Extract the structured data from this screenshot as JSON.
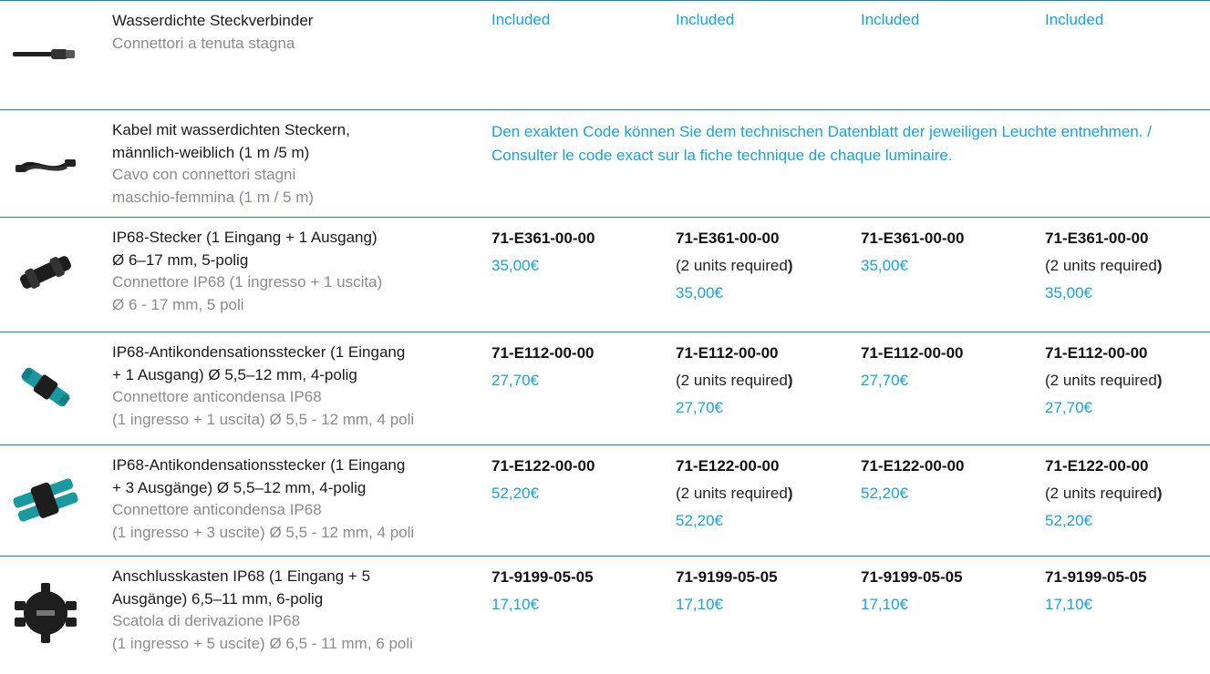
{
  "colors": {
    "accent": "#1aa0dd",
    "rule": "#1f7fc0",
    "secondary_text": "#8b8b8b"
  },
  "rows": [
    {
      "icon": "cable-connector-icon",
      "de": "Wasserdichte Steckverbinder",
      "it_lines": [
        "Connettori a tenuta stagna"
      ],
      "de_lines": [
        "Wasserdichte Steckverbinder"
      ],
      "cells": [
        "Included",
        "Included",
        "Included",
        "Included"
      ]
    },
    {
      "icon": "cable-with-plugs-icon",
      "de_lines": [
        "Kabel mit wasserdichten Steckern,",
        "männlich-weiblich (1 m /5 m)"
      ],
      "it_lines": [
        "Cavo con connettori stagni",
        "maschio-femmina (1 m / 5 m)"
      ],
      "note": "Den exakten Code können Sie dem technischen Datenblatt der jeweiligen Leuchte entnehmen. / Consulter le code exact sur la fiche technique de chaque luminaire."
    },
    {
      "icon": "ip68-connector-icon",
      "de_lines": [
        "IP68-Stecker (1 Eingang + 1 Ausgang)",
        "Ø 6–17 mm, 5-polig"
      ],
      "it_lines": [
        "Connettore IP68 (1 ingresso + 1 uscita)",
        "Ø 6 - 17 mm, 5 poli"
      ],
      "code": "71-E361-00-00",
      "price": "35,00€",
      "units_note": "(2 units required",
      "units_close": ")"
    },
    {
      "icon": "anti-condensation-connector-icon",
      "de_lines": [
        "IP68-Antikondensationsstecker (1 Eingang",
        "+ 1 Ausgang) Ø 5,5–12 mm, 4-polig"
      ],
      "it_lines": [
        "Connettore anticondensa IP68",
        "(1 ingresso + 1 uscita) Ø 5,5 - 12 mm, 4 poli"
      ],
      "code": "71-E112-00-00",
      "price": "27,70€",
      "units_note": "(2 units required",
      "units_close": ")"
    },
    {
      "icon": "triple-output-connector-icon",
      "de_lines": [
        "IP68-Antikondensationsstecker (1 Eingang",
        "+ 3 Ausgänge) Ø 5,5–12 mm, 4-polig"
      ],
      "it_lines": [
        "Connettore anticondensa IP68",
        "(1 ingresso + 3 uscite) Ø 5,5 - 12 mm, 4 poli"
      ],
      "code": "71-E122-00-00",
      "price": "52,20€",
      "units_note": "(2 units required",
      "units_close": ")"
    },
    {
      "icon": "junction-box-icon",
      "de_lines": [
        "Anschlusskasten IP68 (1 Eingang + 5",
        "Ausgänge) 6,5–11 mm, 6-polig"
      ],
      "it_lines": [
        "Scatola di derivazione IP68",
        "(1 ingresso + 5 uscite) Ø 6,5 - 11 mm, 6 poli"
      ],
      "code": "71-9199-05-05",
      "price": "17,10€"
    }
  ]
}
